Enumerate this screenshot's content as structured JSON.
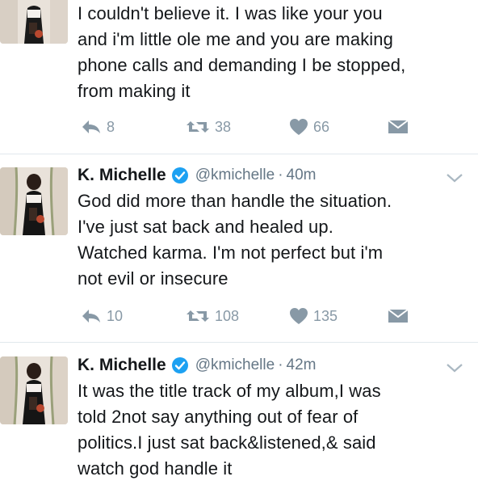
{
  "tweets": [
    {
      "text_lines": [
        "I couldn't believe it. I was like your you",
        "and i'm little ole me and you are making",
        "phone calls and demanding I be stopped,",
        "from making it"
      ],
      "replies": "8",
      "retweets": "38",
      "likes": "66"
    },
    {
      "name": "K. Michelle",
      "handle": "@kmichelle",
      "separator": "·",
      "time": "40m",
      "text_lines": [
        "God did more than handle the situation.",
        "I've just sat back and healed up.",
        "Watched karma. I'm not perfect but i'm",
        "not evil or insecure"
      ],
      "replies": "10",
      "retweets": "108",
      "likes": "135"
    },
    {
      "name": "K. Michelle",
      "handle": "@kmichelle",
      "separator": "·",
      "time": "42m",
      "text_lines": [
        "It was the title track of my album,I was",
        "told 2not say anything out of fear of",
        "politics.I just sat back&listened,& said",
        "watch god handle it"
      ]
    }
  ],
  "icons": {
    "reply": "reply-icon",
    "retweet": "retweet-icon",
    "like": "heart-icon",
    "dm": "envelope-icon",
    "verified": "verified-badge-icon",
    "menu": "chevron-down-icon"
  },
  "colors": {
    "text": "#14171a",
    "secondary": "#657786",
    "action": "#8899a6",
    "verified": "#1da1f2",
    "divider": "#e1e8ed"
  }
}
